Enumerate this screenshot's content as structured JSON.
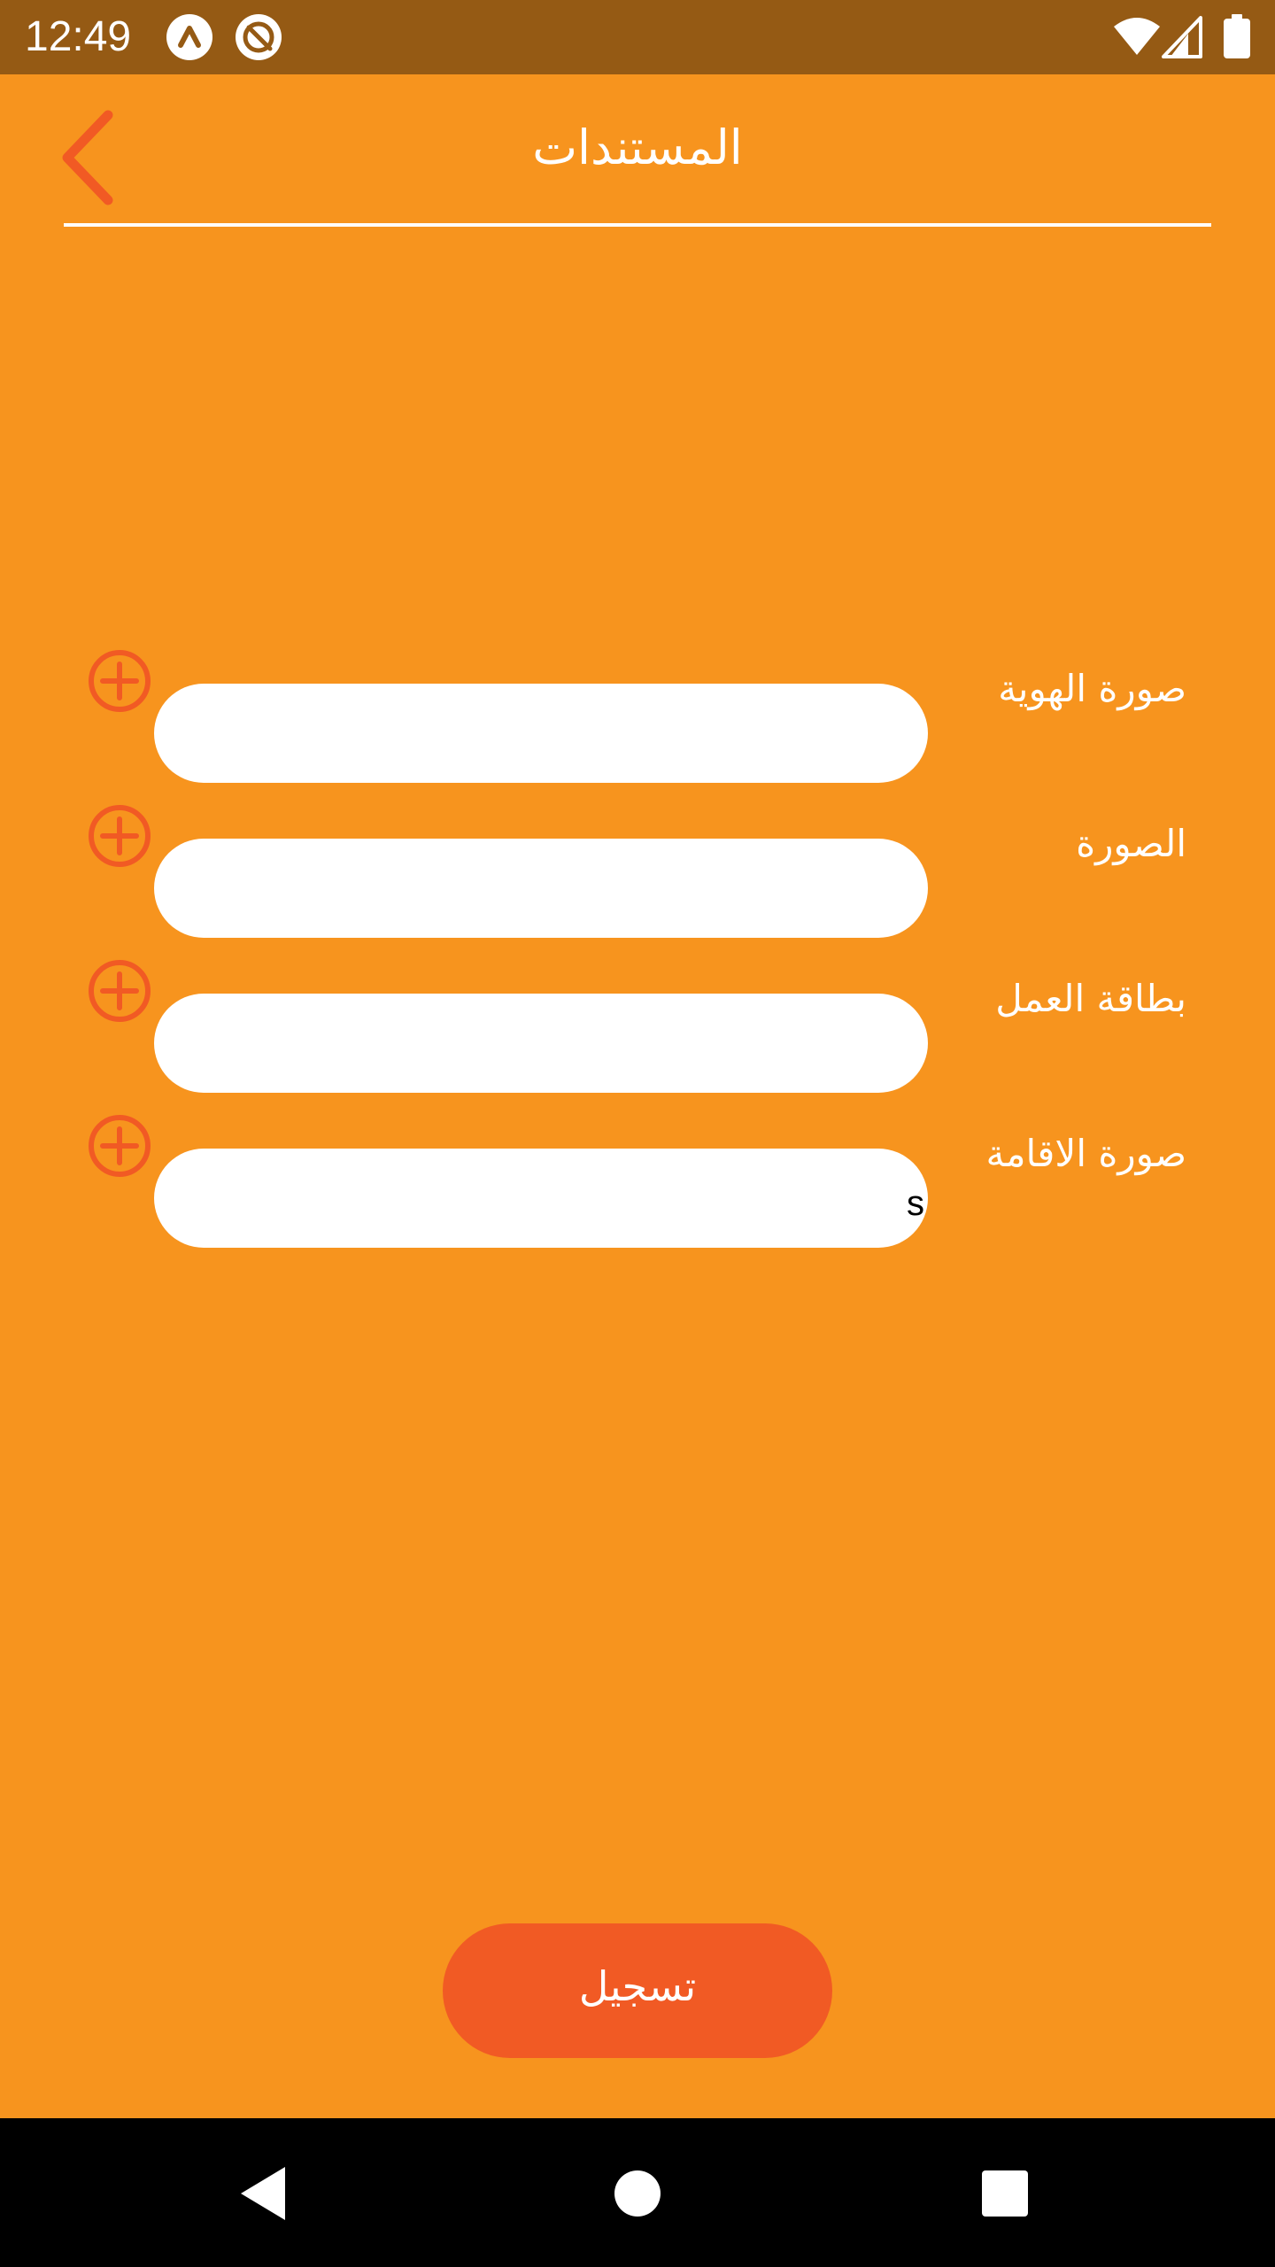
{
  "status_bar": {
    "time": "12:49",
    "icons": [
      "app-notification-icon",
      "sync-blocked-icon",
      "wifi-icon",
      "cell-signal-icon",
      "battery-icon"
    ]
  },
  "header": {
    "title": "المستندات",
    "back_icon": "chevron-left-icon"
  },
  "documents": [
    {
      "label": "صورة الهوية",
      "value": "",
      "add_icon": "add-circle-icon"
    },
    {
      "label": "الصورة",
      "value": "",
      "add_icon": "add-circle-icon"
    },
    {
      "label": "بطاقة العمل",
      "value": "",
      "add_icon": "add-circle-icon"
    },
    {
      "label": "صورة الاقامة",
      "value": "s",
      "add_icon": "add-circle-icon"
    }
  ],
  "submit": {
    "label": "تسجيل"
  },
  "nav_bar": {
    "icons": [
      "back-triangle-icon",
      "home-circle-icon",
      "recents-square-icon"
    ]
  },
  "colors": {
    "background": "#F7941E",
    "status_bar": "#955A14",
    "accent": "#F15A24",
    "field": "#FFFFFF",
    "nav_bar": "#000000"
  }
}
